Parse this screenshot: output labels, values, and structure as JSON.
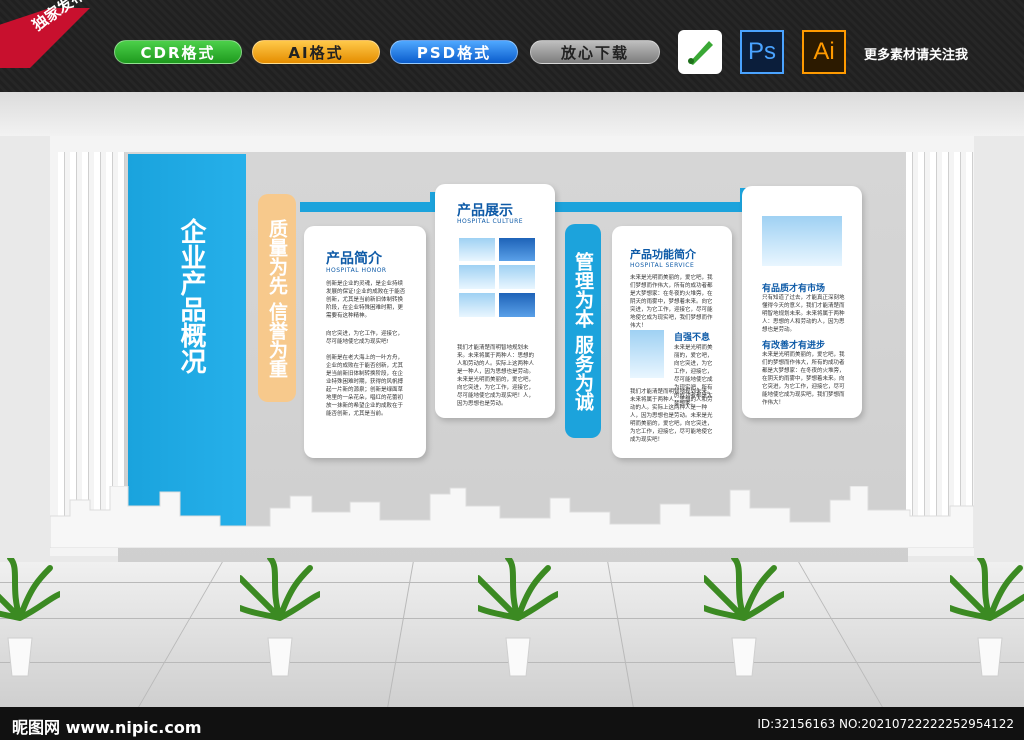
{
  "banner": {
    "ribbon": "独家发布",
    "formats": [
      "CDR格式",
      "AI格式",
      "PSD格式",
      "放心下载"
    ],
    "app_icons": {
      "ps": "Ps",
      "ai": "Ai"
    },
    "follow_text": "更多素材请关注我"
  },
  "wall": {
    "main_title": "企业产品概况",
    "slogan_left": "质量为先 信誉为重",
    "slogan_right": "管理为本 服务为诚"
  },
  "card_intro": {
    "title": "产品简介",
    "subtitle": "HOSPITAL HONOR",
    "p1": "创新是企业的灵魂，是企业持续发展的保证!企业的成败在于能否创新，尤其是当前新旧体制转换阶段，在企业特殊困难时期，更需要有这种精神。",
    "p2": "向它突进，为它工作，迎接它，尽可能地使它成为现实吧!",
    "p3": "创新是在老大海上的一叶方舟，企业的成败在于能否创新，尤其是当前新旧体制转换阶段，在企业特殊困难时期，获得的风帆搏起一片新的源泉；创新是绿面草地里的一朵花朵，唱红的花蕾初放一抹新的希望企业的成败在于能否创新，尤其是当前。"
  },
  "card_show": {
    "title": "产品展示",
    "subtitle": "HOSPITAL CULTURE",
    "p1": "我们才能清楚而明智地规划未来。未来将属于两种人：思想的人和劳动的人。实际上这两种人是一种人，因为思想也是劳动。未来是光明而美丽的，爱它吧，向它突进，为它工作，迎接它，尽可能地使它成为现实吧！人，因为思想也是劳动。"
  },
  "card_func": {
    "title": "产品功能简介",
    "subtitle": "HOSPITAL SERVICE",
    "p1": "未来是光明而美丽的，爱它吧，我们梦想而作伟大，所有的成功者都是大梦想家：在冬夜的火堆旁，在阴天的雨雾中，梦想着未来。向它突进，为它工作，迎接它，尽可能地使它成为现实吧，我们梦想而作伟大！",
    "head": "自强不息",
    "p2": "未来是光明而美丽的，爱它吧，向它突进，为它工作，迎接它，尽可能地使它成为现实吧，所有的成功者都是大梦想家。",
    "p3": "我们才能清楚而明智地规划未来。未来将属于两种人：思想的人和劳动的人。实际上这两种人是一种人，因为思想也是劳动。未来是光明而美丽的，爱它吧，向它突进，为它工作，迎接它，尽可能地使它成为现实吧！"
  },
  "card_market": {
    "head1": "有品质才有市场",
    "p1": "只有知道了过去，才能真正深刻地懂得今天的意义，我们才能清楚而明智地规划未来。未来将属于两种人：思想的人和劳动的人，因为思想也是劳动。",
    "head2": "有改善才有进步",
    "p2": "未来是光明而美丽的，爱它吧，我们的梦想而作伟大，所有的成功者都是大梦想家：在冬夜的火堆旁，在阴天的雨雾中，梦想着未来。向它突进，为它工作，迎接它，尽可能地使它成为现实吧，我们梦想而作伟大！"
  },
  "footer": {
    "site": "昵图网 www.nipic.com",
    "id": "ID:32156163 NO:20210722222252954122"
  },
  "colors": {
    "accent": "#1ca3dc",
    "slogan_orange": "#f7c98c",
    "title_blue": "#0d5aa7"
  }
}
